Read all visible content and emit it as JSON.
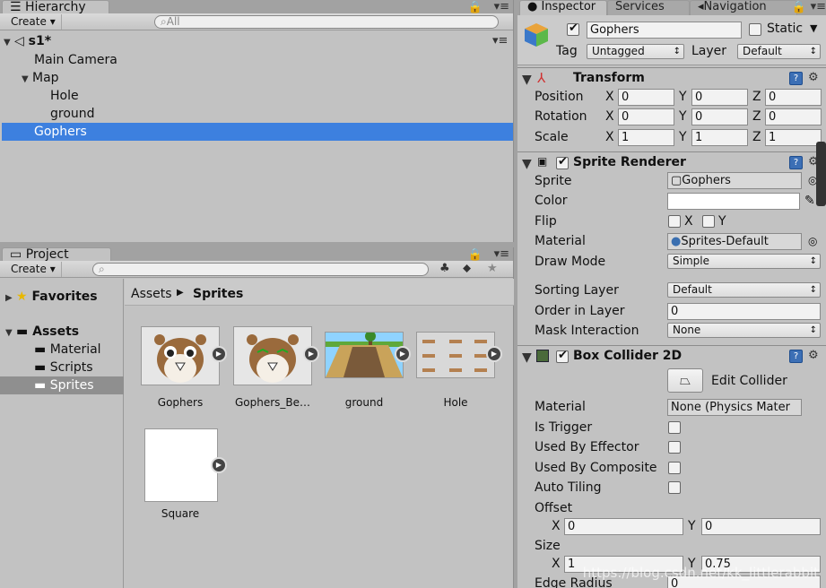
{
  "hierarchy": {
    "tab_label": "Hierarchy",
    "create_label": "Create ▾",
    "search_placeholder": "All",
    "scene_name": "s1*",
    "items": [
      {
        "label": "Main Camera"
      },
      {
        "label": "Map"
      },
      {
        "label": "Hole"
      },
      {
        "label": "ground"
      },
      {
        "label": "Gophers"
      }
    ]
  },
  "project": {
    "tab_label": "Project",
    "create_label": "Create ▾",
    "favorites_label": "Favorites",
    "assets_label": "Assets",
    "folders": [
      "Material",
      "Scripts",
      "Sprites"
    ],
    "breadcrumb": {
      "root": "Assets",
      "current": "Sprites"
    },
    "assets": [
      "Gophers",
      "Gophers_Be…",
      "ground",
      "Hole",
      "Square"
    ]
  },
  "inspector": {
    "tabs": [
      "Inspector",
      "Services",
      "Navigation"
    ],
    "object_name": "Gophers",
    "static_label": "Static",
    "tag_label": "Tag",
    "tag_value": "Untagged",
    "layer_label": "Layer",
    "layer_value": "Default",
    "transform": {
      "title": "Transform",
      "position_label": "Position",
      "rotation_label": "Rotation",
      "scale_label": "Scale",
      "position": {
        "x": "0",
        "y": "0",
        "z": "0"
      },
      "rotation": {
        "x": "0",
        "y": "0",
        "z": "0"
      },
      "scale": {
        "x": "1",
        "y": "1",
        "z": "1"
      }
    },
    "sprite_renderer": {
      "title": "Sprite Renderer",
      "sprite_label": "Sprite",
      "sprite_value": "Gophers",
      "color_label": "Color",
      "flip_label": "Flip",
      "flip_x": "X",
      "flip_y": "Y",
      "material_label": "Material",
      "material_value": "Sprites-Default",
      "draw_mode_label": "Draw Mode",
      "draw_mode_value": "Simple",
      "sorting_layer_label": "Sorting Layer",
      "sorting_layer_value": "Default",
      "order_label": "Order in Layer",
      "order_value": "0",
      "mask_label": "Mask Interaction",
      "mask_value": "None"
    },
    "box_collider": {
      "title": "Box Collider 2D",
      "edit_label": "Edit Collider",
      "material_label": "Material",
      "material_value": "None (Physics Mater",
      "is_trigger_label": "Is Trigger",
      "used_by_effector_label": "Used By Effector",
      "used_by_composite_label": "Used By Composite",
      "auto_tiling_label": "Auto Tiling",
      "offset_label": "Offset",
      "offset": {
        "x": "0",
        "y": "0"
      },
      "size_label": "Size",
      "size": {
        "x": "1",
        "y": "0.75"
      },
      "edge_radius_label": "Edge Radius",
      "edge_radius_value": "0"
    },
    "watermark": "https://blog.csdn.net/kk_littlerabbit"
  },
  "colors": {
    "selection": "#3d80df",
    "panel": "#c2c2c2"
  }
}
